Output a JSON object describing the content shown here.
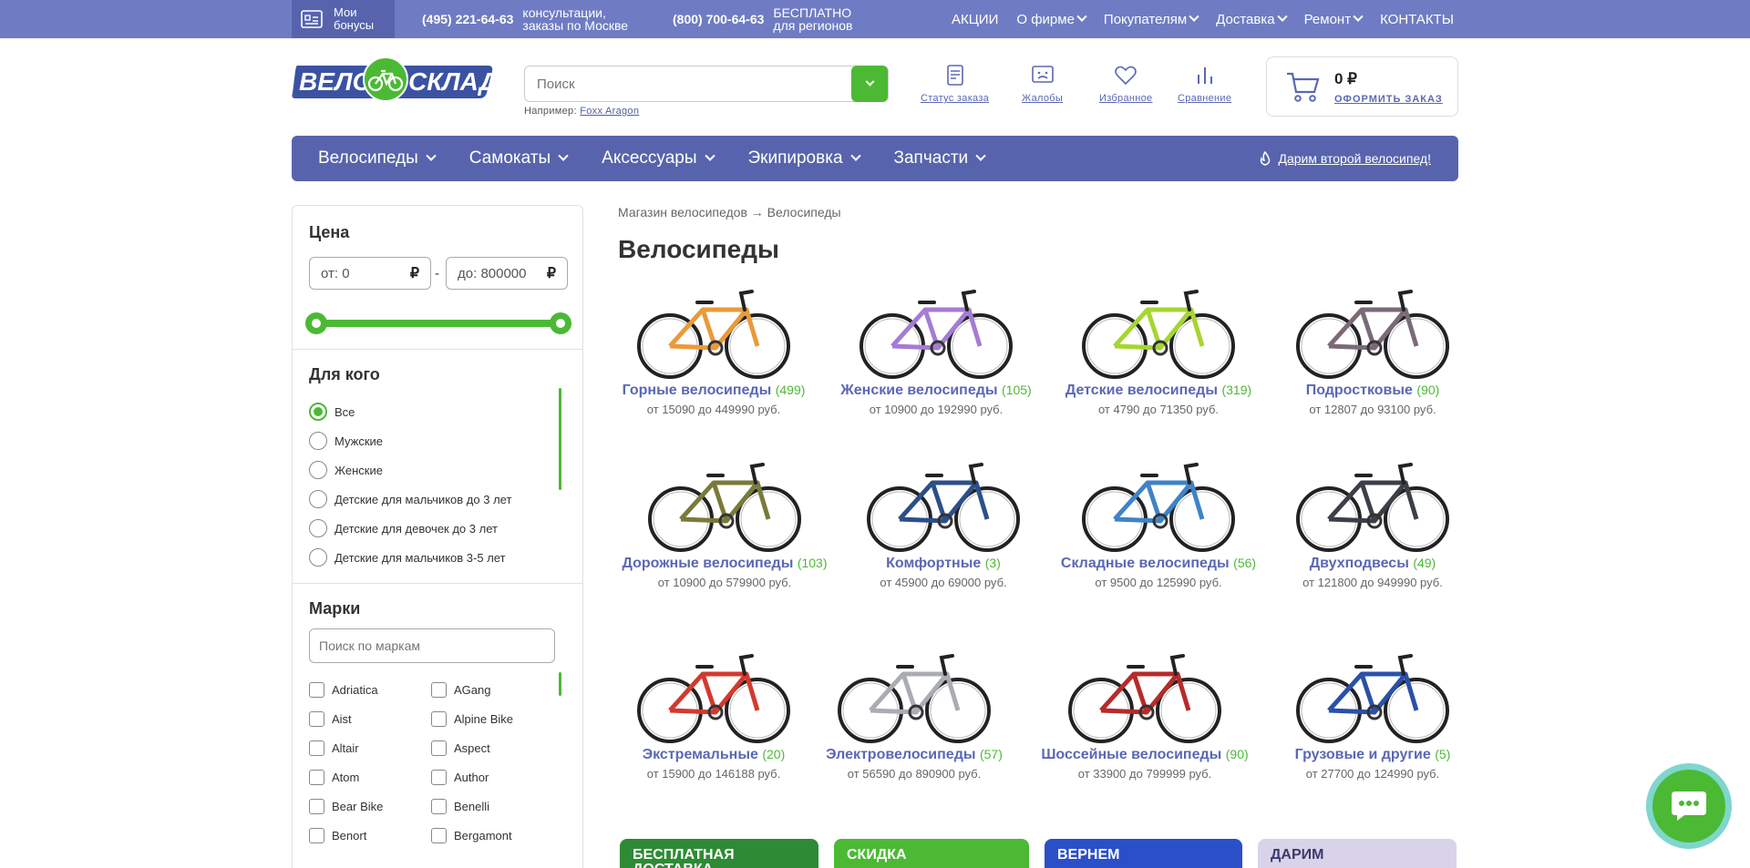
{
  "topbar": {
    "bonus_label": "Мои бонусы",
    "phone1": "(495) 221-64-63",
    "phone1_note": "консультации, заказы по Москве",
    "phone2": "(800) 700-64-63",
    "phone2_note": "БЕСПЛАТНО для регионов",
    "menu": [
      "АКЦИИ",
      "О фирме",
      "Покупателям",
      "Доставка",
      "Ремонт",
      "КОНТАКТЫ"
    ]
  },
  "logo": {
    "left": "ВЕЛО",
    "right": "СКЛАД"
  },
  "search": {
    "placeholder": "Поиск",
    "hint_prefix": "Например:",
    "hint_link": "Foxx Aragon"
  },
  "header_icons": [
    "Статус заказа",
    "Жалобы",
    "Избранное",
    "Сравнение"
  ],
  "cart": {
    "sum": "0 ₽",
    "order_label": "ОФОРМИТЬ ЗАКАЗ"
  },
  "nav": {
    "items": [
      "Велосипеды",
      "Самокаты",
      "Аксессуары",
      "Экипировка",
      "Запчасти"
    ],
    "promo": "Дарим второй велосипед!"
  },
  "filters": {
    "price_title": "Цена",
    "price_from_prefix": "от:",
    "price_from": "0",
    "price_to_prefix": "до:",
    "price_to": "800000",
    "currency": "₽",
    "dash": "-",
    "who_title": "Для кого",
    "who_options": [
      "Все",
      "Мужские",
      "Женские",
      "Детские для мальчиков до 3 лет",
      "Детские для девочек до 3 лет",
      "Детские для мальчиков 3-5 лет"
    ],
    "who_selected": "Все",
    "brands_title": "Марки",
    "brands_placeholder": "Поиск по маркам",
    "brands": [
      "Adriatica",
      "AGang",
      "Aist",
      "Alpine Bike",
      "Altair",
      "Aspect",
      "Atom",
      "Author",
      "Bear Bike",
      "Benelli",
      "Benort",
      "Bergamont"
    ]
  },
  "breadcrumb": {
    "home": "Магазин велосипедов",
    "arrow": "→",
    "current": "Велосипеды"
  },
  "page_title": "Велосипеды",
  "categories": [
    {
      "name": "Горные велосипеды",
      "count": "(499)",
      "price": "от 15090 до 449990 руб.",
      "color": "#e99a3a"
    },
    {
      "name": "Женские велосипеды",
      "count": "(105)",
      "price": "от 10900 до 192990 руб.",
      "color": "#a57bd4"
    },
    {
      "name": "Детские велосипеды",
      "count": "(319)",
      "price": "от 4790 до 71350 руб.",
      "color": "#a5d62f"
    },
    {
      "name": "Подростковые",
      "count": "(90)",
      "price": "от 12807 до 93100 руб.",
      "color": "#7a6a78"
    },
    {
      "name": "Дорожные велосипеды",
      "count": "(103)",
      "price": "от 10900 до 579900 руб.",
      "color": "#7a7a3a"
    },
    {
      "name": "Комфортные",
      "count": "(3)",
      "price": "от 45900 до 69000 руб.",
      "color": "#2c4f8a"
    },
    {
      "name": "Складные велосипеды",
      "count": "(56)",
      "price": "от 9500 до 125990 руб.",
      "color": "#3f83c8"
    },
    {
      "name": "Двухподвесы",
      "count": "(49)",
      "price": "от 121800 до 949990 руб.",
      "color": "#3b3f48"
    },
    {
      "name": "Экстремальные",
      "count": "(20)",
      "price": "от 15900 до 146188 руб.",
      "color": "#d23a2e"
    },
    {
      "name": "Электровелосипеды",
      "count": "(57)",
      "price": "от 56590 до 890900 руб.",
      "color": "#a9adb3"
    },
    {
      "name": "Шоссейные велосипеды",
      "count": "(90)",
      "price": "от 33900 до 799999 руб.",
      "color": "#b72a2a"
    },
    {
      "name": "Грузовые и другие",
      "count": "(5)",
      "price": "от 27700 до 124990 руб.",
      "color": "#2a50a8"
    }
  ],
  "banners": [
    {
      "text": "БЕСПЛАТНАЯ ДОСТАВКА",
      "color": "#2e8a35"
    },
    {
      "text": "СКИДКА",
      "color": "#4cb935"
    },
    {
      "text": "ВЕРНЕМ",
      "color": "#2b4fc9"
    },
    {
      "text": "ДАРИМ",
      "color": "#d9d3ea"
    }
  ],
  "colors": {
    "accent_green": "#4cb935",
    "brand_blue": "#5764ad",
    "topbar": "#6f7cc3",
    "link": "#5a68b4"
  }
}
